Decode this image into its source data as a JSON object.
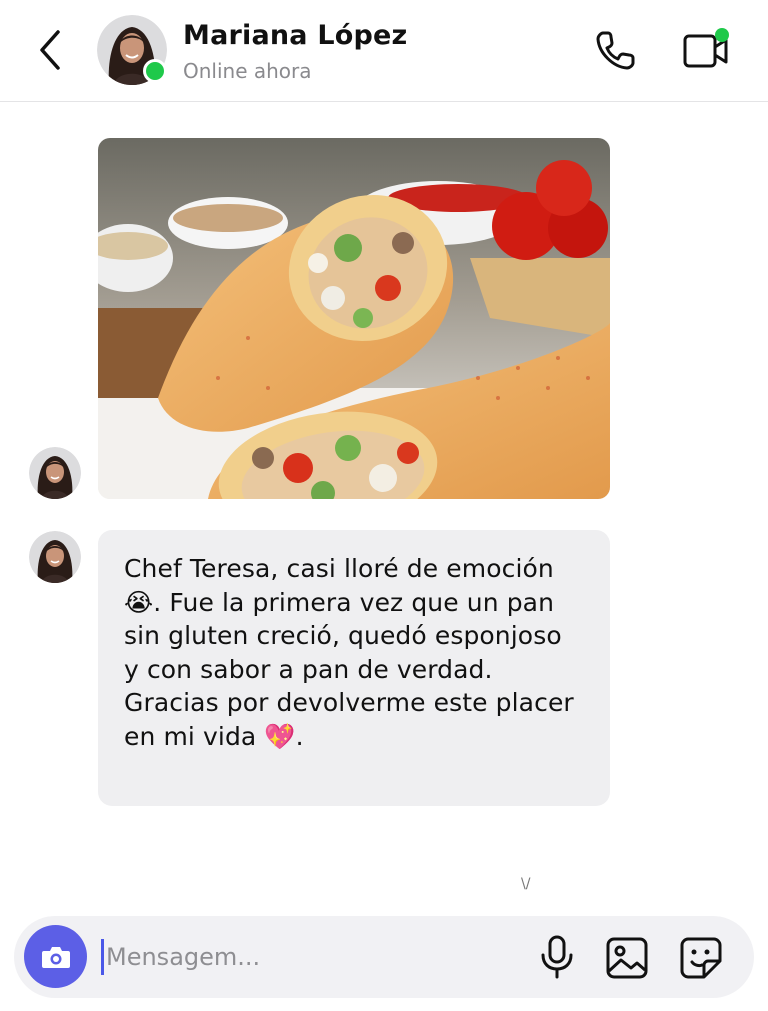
{
  "header": {
    "contact_name": "Mariana López",
    "status": "Online ahora",
    "back_icon": "chevron-left-icon",
    "call_icon": "phone-icon",
    "video_icon": "video-call-icon",
    "online_color": "#1fc94a"
  },
  "messages": [
    {
      "type": "image",
      "description_icon": "food-photo",
      "sender": "Mariana López"
    },
    {
      "type": "text",
      "text": "Chef Teresa, casi lloré de emoción 😭. Fue la primera vez que un pan sin gluten creció, quedó esponjoso y con sabor a pan de verdad. Gracias por devolverme este placer en mi vida 💖."
    }
  ],
  "scroll_hint": "\\/",
  "composer": {
    "placeholder": "Mensagem...",
    "value": "",
    "camera_icon": "camera-icon",
    "mic_icon": "microphone-icon",
    "gallery_icon": "image-gallery-icon",
    "sticker_icon": "sticker-icon",
    "accent_color": "#5c5fe6"
  }
}
